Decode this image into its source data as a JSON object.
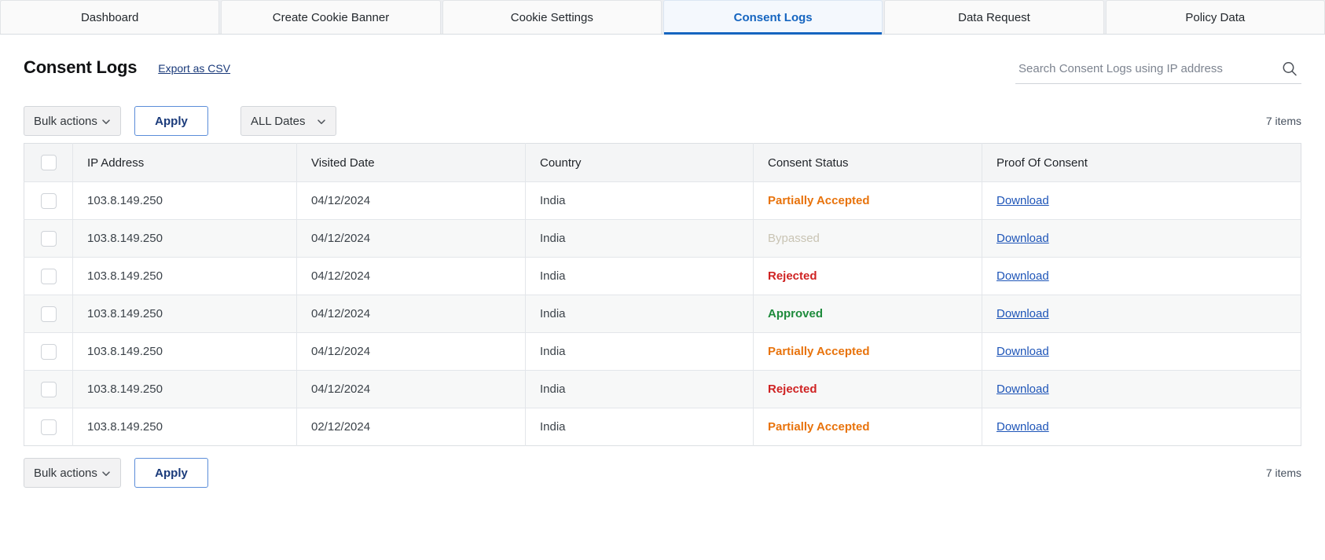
{
  "tabs": [
    {
      "label": "Dashboard",
      "active": false
    },
    {
      "label": "Create Cookie Banner",
      "active": false
    },
    {
      "label": "Cookie Settings",
      "active": false
    },
    {
      "label": "Consent Logs",
      "active": true
    },
    {
      "label": "Data Request",
      "active": false
    },
    {
      "label": "Policy Data",
      "active": false
    }
  ],
  "header": {
    "title": "Consent Logs",
    "export_label": "Export as CSV"
  },
  "search": {
    "placeholder": "Search Consent Logs using IP address",
    "value": "",
    "icon": "search-icon"
  },
  "toolbar_top": {
    "bulk_actions_label": "Bulk actions",
    "apply_label": "Apply",
    "dates_label": "ALL Dates",
    "item_count": "7 items",
    "caret_icon": "chevron-down-icon"
  },
  "toolbar_bottom": {
    "bulk_actions_label": "Bulk actions",
    "apply_label": "Apply",
    "item_count": "7 items",
    "caret_icon": "chevron-down-icon"
  },
  "table": {
    "columns": [
      "IP Address",
      "Visited Date",
      "Country",
      "Consent Status",
      "Proof Of Consent"
    ],
    "download_label": "Download",
    "rows": [
      {
        "ip": "103.8.149.250",
        "date": "04/12/2024",
        "country": "India",
        "status": "Partially Accepted",
        "status_kind": "partial",
        "proof": "Download",
        "checked": false
      },
      {
        "ip": "103.8.149.250",
        "date": "04/12/2024",
        "country": "India",
        "status": "Bypassed",
        "status_kind": "bypassed",
        "proof": "Download",
        "checked": false
      },
      {
        "ip": "103.8.149.250",
        "date": "04/12/2024",
        "country": "India",
        "status": "Rejected",
        "status_kind": "rejected",
        "proof": "Download",
        "checked": false
      },
      {
        "ip": "103.8.149.250",
        "date": "04/12/2024",
        "country": "India",
        "status": "Approved",
        "status_kind": "approved",
        "proof": "Download",
        "checked": false
      },
      {
        "ip": "103.8.149.250",
        "date": "04/12/2024",
        "country": "India",
        "status": "Partially Accepted",
        "status_kind": "partial",
        "proof": "Download",
        "checked": false
      },
      {
        "ip": "103.8.149.250",
        "date": "04/12/2024",
        "country": "India",
        "status": "Rejected",
        "status_kind": "rejected",
        "proof": "Download",
        "checked": false
      },
      {
        "ip": "103.8.149.250",
        "date": "02/12/2024",
        "country": "India",
        "status": "Partially Accepted",
        "status_kind": "partial",
        "proof": "Download",
        "checked": false
      }
    ]
  },
  "colors": {
    "accent": "#1565c0",
    "link": "#1e55b8",
    "status_partial": "#e8730c",
    "status_bypassed": "#c9c4b4",
    "status_rejected": "#cf2323",
    "status_approved": "#1e8b3c"
  }
}
